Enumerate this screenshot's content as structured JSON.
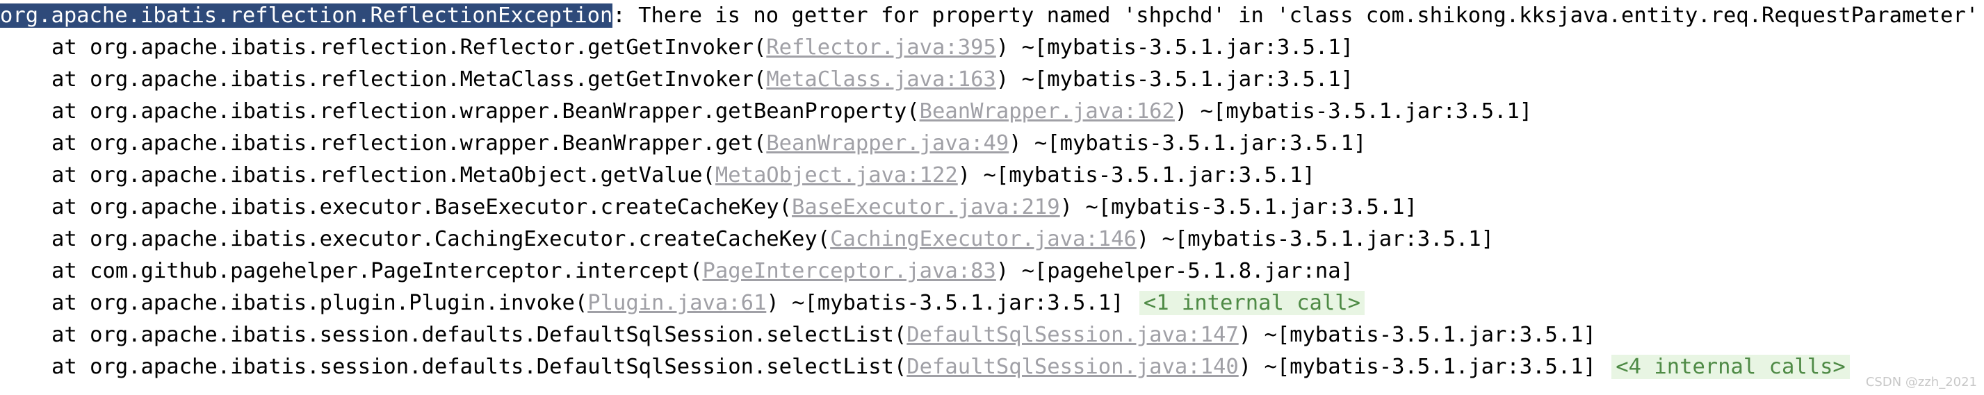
{
  "exception": {
    "class": "org.apache.ibatis.reflection.ReflectionException",
    "message": ": There is no getter for property named 'shpchd' in 'class com.shikong.kksjava.entity.req.RequestParameter'"
  },
  "frames": [
    {
      "prefix": "at org.apache.ibatis.reflection.Reflector.getGetInvoker(",
      "link": "Reflector.java:395",
      "suffix": ") ~[mybatis-3.5.1.jar:3.5.1]",
      "folded": ""
    },
    {
      "prefix": "at org.apache.ibatis.reflection.MetaClass.getGetInvoker(",
      "link": "MetaClass.java:163",
      "suffix": ") ~[mybatis-3.5.1.jar:3.5.1]",
      "folded": ""
    },
    {
      "prefix": "at org.apache.ibatis.reflection.wrapper.BeanWrapper.getBeanProperty(",
      "link": "BeanWrapper.java:162",
      "suffix": ") ~[mybatis-3.5.1.jar:3.5.1]",
      "folded": ""
    },
    {
      "prefix": "at org.apache.ibatis.reflection.wrapper.BeanWrapper.get(",
      "link": "BeanWrapper.java:49",
      "suffix": ") ~[mybatis-3.5.1.jar:3.5.1]",
      "folded": ""
    },
    {
      "prefix": "at org.apache.ibatis.reflection.MetaObject.getValue(",
      "link": "MetaObject.java:122",
      "suffix": ") ~[mybatis-3.5.1.jar:3.5.1]",
      "folded": ""
    },
    {
      "prefix": "at org.apache.ibatis.executor.BaseExecutor.createCacheKey(",
      "link": "BaseExecutor.java:219",
      "suffix": ") ~[mybatis-3.5.1.jar:3.5.1]",
      "folded": ""
    },
    {
      "prefix": "at org.apache.ibatis.executor.CachingExecutor.createCacheKey(",
      "link": "CachingExecutor.java:146",
      "suffix": ") ~[mybatis-3.5.1.jar:3.5.1]",
      "folded": ""
    },
    {
      "prefix": "at com.github.pagehelper.PageInterceptor.intercept(",
      "link": "PageInterceptor.java:83",
      "suffix": ") ~[pagehelper-5.1.8.jar:na]",
      "folded": ""
    },
    {
      "prefix": "at org.apache.ibatis.plugin.Plugin.invoke(",
      "link": "Plugin.java:61",
      "suffix": ") ~[mybatis-3.5.1.jar:3.5.1]",
      "folded": "<1 internal call>"
    },
    {
      "prefix": "at org.apache.ibatis.session.defaults.DefaultSqlSession.selectList(",
      "link": "DefaultSqlSession.java:147",
      "suffix": ") ~[mybatis-3.5.1.jar:3.5.1]",
      "folded": ""
    },
    {
      "prefix": "at org.apache.ibatis.session.defaults.DefaultSqlSession.selectList(",
      "link": "DefaultSqlSession.java:140",
      "suffix": ") ~[mybatis-3.5.1.jar:3.5.1]",
      "folded": "<4 internal calls>"
    }
  ],
  "watermark": "CSDN @zzh_2021",
  "colors": {
    "selection_bg": "#2e4a7a",
    "link": "#a0a0a6",
    "folded_bg": "#e8f5e3",
    "folded_text": "#4e8a45"
  }
}
